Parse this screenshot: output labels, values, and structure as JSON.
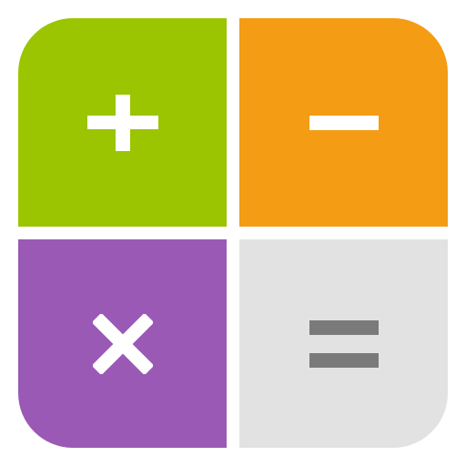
{
  "app_icon": {
    "tiles": [
      {
        "id": "add",
        "icon": "plus-icon",
        "background": "#9AC500",
        "symbol_color": "#FFFFFF"
      },
      {
        "id": "subtract",
        "icon": "minus-icon",
        "background": "#F39C14",
        "symbol_color": "#FFFFFF"
      },
      {
        "id": "multiply",
        "icon": "multiply-icon",
        "background": "#9B59B6",
        "symbol_color": "#FFFFFF"
      },
      {
        "id": "equals",
        "icon": "equals-icon",
        "background": "#E2E2E2",
        "symbol_color": "#7A7A7A"
      }
    ],
    "gap_color": "#FFFFFF"
  }
}
